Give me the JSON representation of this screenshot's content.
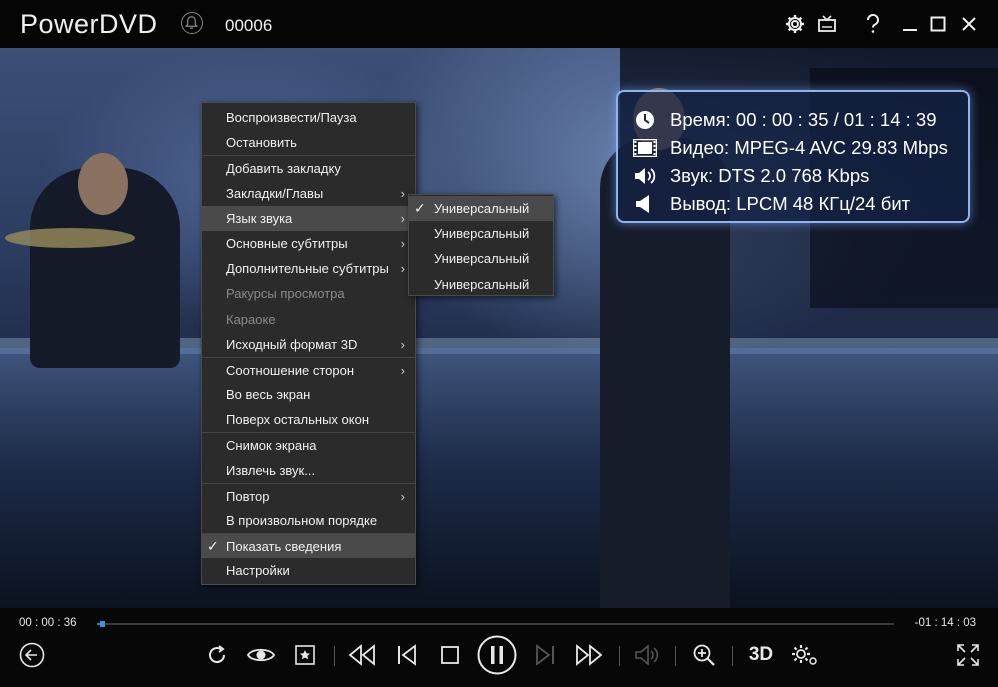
{
  "app": {
    "title": "PowerDVD",
    "file_name": "00006"
  },
  "info": {
    "time": "Время: 00 : 00 : 35 / 01 : 14 : 39",
    "video": "Видео: MPEG-4 AVC  29.83 Mbps",
    "audio": "Звук: DTS 2.0  768 Kbps",
    "output": "Вывод: LPCM 48 КГц/24 бит"
  },
  "menu": {
    "items": [
      {
        "label": "Воспроизвести/Пауза"
      },
      {
        "label": "Остановить"
      },
      {
        "label": "Добавить закладку"
      },
      {
        "label": "Закладки/Главы"
      },
      {
        "label": "Язык звука"
      },
      {
        "label": "Основные субтитры"
      },
      {
        "label": "Дополнительные субтитры"
      },
      {
        "label": "Ракурсы просмотра"
      },
      {
        "label": "Караоке"
      },
      {
        "label": "Исходный формат 3D"
      },
      {
        "label": "Соотношение сторон"
      },
      {
        "label": "Во весь экран"
      },
      {
        "label": "Поверх остальных окон"
      },
      {
        "label": "Снимок экрана"
      },
      {
        "label": "Извлечь звук..."
      },
      {
        "label": "Повтор"
      },
      {
        "label": "В произвольном порядке"
      },
      {
        "label": "Показать сведения"
      },
      {
        "label": "Настройки"
      }
    ]
  },
  "submenu": {
    "items": [
      {
        "label": "Универсальный"
      },
      {
        "label": "Универсальный"
      },
      {
        "label": "Универсальный"
      },
      {
        "label": "Универсальный"
      }
    ]
  },
  "playback": {
    "elapsed": "00 : 00 : 36",
    "remaining": "-01 : 14 : 03",
    "progress_fraction": 0.008,
    "threed_label": "3D"
  },
  "colors": {
    "accent": "#3b78d8",
    "info_border": "#8eb4ee"
  }
}
